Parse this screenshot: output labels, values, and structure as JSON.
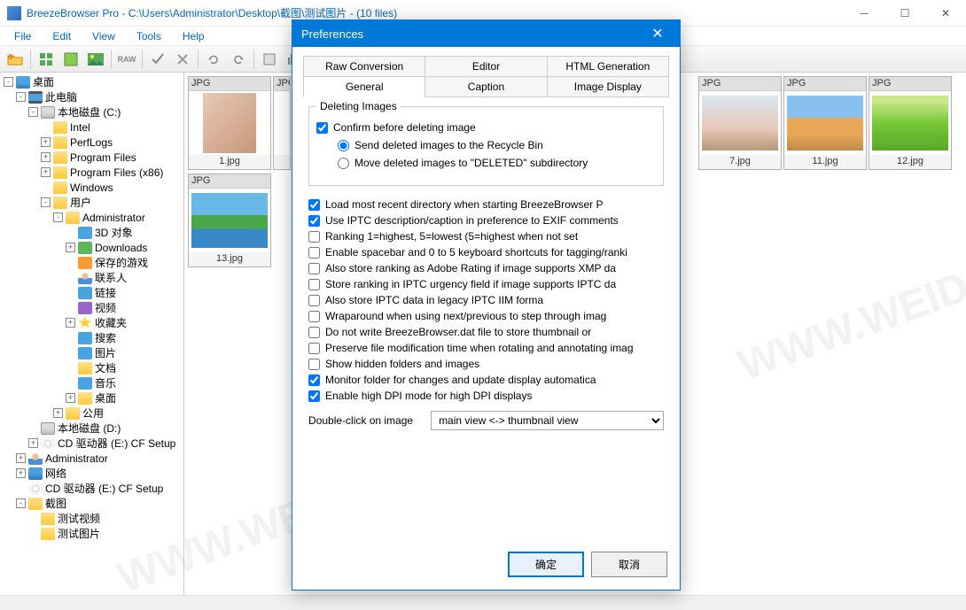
{
  "titlebar": "BreezeBrowser Pro - C:\\Users\\Administrator\\Desktop\\截图\\测试图片 - (10 files)",
  "menu": [
    "File",
    "Edit",
    "View",
    "Tools",
    "Help"
  ],
  "tree": [
    {
      "d": 0,
      "exp": "-",
      "ico": "desktop",
      "t": "桌面"
    },
    {
      "d": 1,
      "exp": "-",
      "ico": "computer",
      "t": "此电脑"
    },
    {
      "d": 2,
      "exp": "-",
      "ico": "drive",
      "t": "本地磁盘 (C:)"
    },
    {
      "d": 3,
      "exp": "",
      "ico": "folder",
      "t": "Intel"
    },
    {
      "d": 3,
      "exp": "+",
      "ico": "folder",
      "t": "PerfLogs"
    },
    {
      "d": 3,
      "exp": "+",
      "ico": "folder",
      "t": "Program Files"
    },
    {
      "d": 3,
      "exp": "+",
      "ico": "folder",
      "t": "Program Files (x86)"
    },
    {
      "d": 3,
      "exp": "",
      "ico": "folder",
      "t": "Windows"
    },
    {
      "d": 3,
      "exp": "-",
      "ico": "folder",
      "t": "用户"
    },
    {
      "d": 4,
      "exp": "-",
      "ico": "folder",
      "t": "Administrator"
    },
    {
      "d": 5,
      "exp": "",
      "ico": "blue",
      "t": "3D 对象"
    },
    {
      "d": 5,
      "exp": "+",
      "ico": "green",
      "t": "Downloads"
    },
    {
      "d": 5,
      "exp": "",
      "ico": "orange",
      "t": "保存的游戏"
    },
    {
      "d": 5,
      "exp": "",
      "ico": "user",
      "t": "联系人"
    },
    {
      "d": 5,
      "exp": "",
      "ico": "blue",
      "t": "链接"
    },
    {
      "d": 5,
      "exp": "",
      "ico": "purple",
      "t": "视频"
    },
    {
      "d": 5,
      "exp": "+",
      "ico": "star",
      "t": "收藏夹"
    },
    {
      "d": 5,
      "exp": "",
      "ico": "blue",
      "t": "搜索"
    },
    {
      "d": 5,
      "exp": "",
      "ico": "blue",
      "t": "图片"
    },
    {
      "d": 5,
      "exp": "",
      "ico": "folder",
      "t": "文档"
    },
    {
      "d": 5,
      "exp": "",
      "ico": "blue",
      "t": "音乐"
    },
    {
      "d": 5,
      "exp": "+",
      "ico": "folder",
      "t": "桌面"
    },
    {
      "d": 4,
      "exp": "+",
      "ico": "folder",
      "t": "公用"
    },
    {
      "d": 2,
      "exp": "",
      "ico": "drive",
      "t": "本地磁盘 (D:)"
    },
    {
      "d": 2,
      "exp": "+",
      "ico": "cd",
      "t": "CD 驱动器 (E:) CF Setup"
    },
    {
      "d": 1,
      "exp": "+",
      "ico": "user",
      "t": "Administrator"
    },
    {
      "d": 1,
      "exp": "+",
      "ico": "network",
      "t": "网络"
    },
    {
      "d": 1,
      "exp": "",
      "ico": "cd",
      "t": "CD 驱动器 (E:) CF Setup"
    },
    {
      "d": 1,
      "exp": "-",
      "ico": "folder",
      "t": "截图"
    },
    {
      "d": 2,
      "exp": "",
      "ico": "folder",
      "t": "测试视频"
    },
    {
      "d": 2,
      "exp": "",
      "ico": "folder",
      "t": "测试图片"
    }
  ],
  "thumbs": [
    {
      "type": "JPG",
      "name": "1.jpg",
      "style": "background:linear-gradient(135deg,#e8c8b8,#c89878);",
      "cls": "img-portrait",
      "col": 0,
      "row": 0
    },
    {
      "type": "JPG",
      "name": "",
      "style": "",
      "col": 1,
      "row": 0,
      "hidden": true
    },
    {
      "type": "JPG",
      "name": "7.jpg",
      "style": "background:linear-gradient(#d8e8f0,#e8c8b8 60%,#b89878);",
      "col": 6,
      "row": 0
    },
    {
      "type": "JPG",
      "name": "11.jpg",
      "style": "background:linear-gradient(#88c0f0 40%,#e8a858 40% 70%,#c08848);",
      "col": 7,
      "row": 0
    },
    {
      "type": "JPG",
      "name": "12.jpg",
      "style": "background:linear-gradient(#c8e888 10%,#78c838 50%,#58a828);",
      "col": 8,
      "row": 0
    },
    {
      "type": "JPG",
      "name": "13.jpg",
      "style": "background:linear-gradient(#68b8e8 40%,#48a848 40% 65%,#3888c8 65%);",
      "col": 0,
      "row": 1
    }
  ],
  "dialog": {
    "title": "Preferences",
    "tabs_upper": [
      "Raw Conversion",
      "Editor",
      "HTML Generation"
    ],
    "tabs_lower": [
      "General",
      "Caption",
      "Image Display"
    ],
    "active_tab": "General",
    "group_title": "Deleting Images",
    "confirm_delete": "Confirm before deleting image",
    "radio_recycle": "Send deleted images to the Recycle Bin",
    "radio_deleted": "Move deleted images to \"DELETED\" subdirectory",
    "opts": [
      {
        "c": true,
        "t": "Load most recent directory when starting BreezeBrowser P"
      },
      {
        "c": true,
        "t": "Use IPTC description/caption in preference to EXIF comments"
      },
      {
        "c": false,
        "t": "Ranking 1=highest, 5=lowest (5=highest when not set"
      },
      {
        "c": false,
        "t": "Enable spacebar and 0 to 5 keyboard shortcuts for tagging/ranki"
      },
      {
        "c": false,
        "t": "Also store ranking as Adobe Rating if image supports XMP da"
      },
      {
        "c": false,
        "t": "Store ranking in IPTC urgency field if image supports IPTC da"
      },
      {
        "c": false,
        "t": "Also store IPTC data in legacy IPTC IIM forma"
      },
      {
        "c": false,
        "t": "Wraparound when using next/previous to step through imag"
      },
      {
        "c": false,
        "t": "Do not write BreezeBrowser.dat file to store thumbnail or"
      },
      {
        "c": false,
        "t": "Preserve file modification time when rotating and annotating imag"
      },
      {
        "c": false,
        "t": "Show hidden folders and images"
      },
      {
        "c": true,
        "t": "Monitor folder for changes and update display automatica"
      },
      {
        "c": true,
        "t": "Enable high DPI mode for high DPI displays"
      }
    ],
    "dd_label": "Double-click on image",
    "dd_value": "main view <-> thumbnail view",
    "ok": "确定",
    "cancel": "取消"
  }
}
